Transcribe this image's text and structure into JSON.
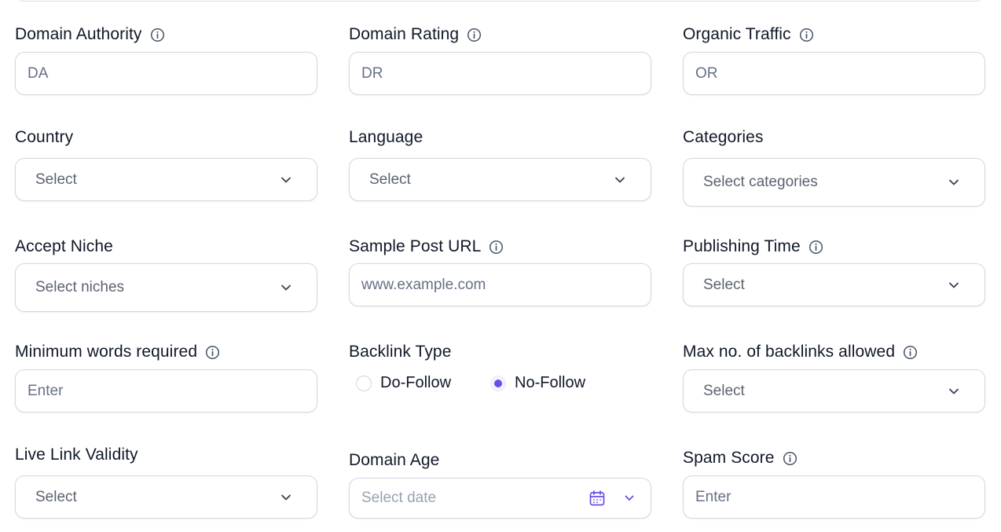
{
  "fields": {
    "da": {
      "label": "Domain Authority",
      "placeholder": "DA"
    },
    "dr": {
      "label": "Domain Rating",
      "placeholder": "DR"
    },
    "or": {
      "label": "Organic Traffic",
      "placeholder": "OR"
    },
    "country": {
      "label": "Country",
      "value": "Select"
    },
    "language": {
      "label": "Language",
      "value": "Select"
    },
    "categories": {
      "label": "Categories",
      "value": "Select categories"
    },
    "niche": {
      "label": "Accept Niche",
      "value": "Select niches"
    },
    "sample_url": {
      "label": "Sample Post URL",
      "placeholder": "www.example.com"
    },
    "publishing_time": {
      "label": "Publishing Time",
      "value": "Select"
    },
    "min_words": {
      "label": "Minimum words required",
      "placeholder": "Enter"
    },
    "backlink_type": {
      "label": "Backlink Type",
      "options": [
        "Do-Follow",
        "No-Follow"
      ],
      "selected": "No-Follow"
    },
    "max_backlinks": {
      "label": "Max no. of backlinks allowed",
      "value": "Select"
    },
    "live_link": {
      "label": "Live Link Validity",
      "value": "Select"
    },
    "domain_age": {
      "label": "Domain Age",
      "placeholder": "Select date"
    },
    "spam_score": {
      "label": "Spam Score",
      "placeholder": "Enter"
    }
  },
  "colors": {
    "accent": "#6c4de6",
    "border": "#d5d7dd",
    "text": "#101828",
    "placeholder": "#667085"
  },
  "icons": {
    "info": "info-circle-icon",
    "chevron": "chevron-down-icon",
    "calendar": "calendar-icon"
  }
}
